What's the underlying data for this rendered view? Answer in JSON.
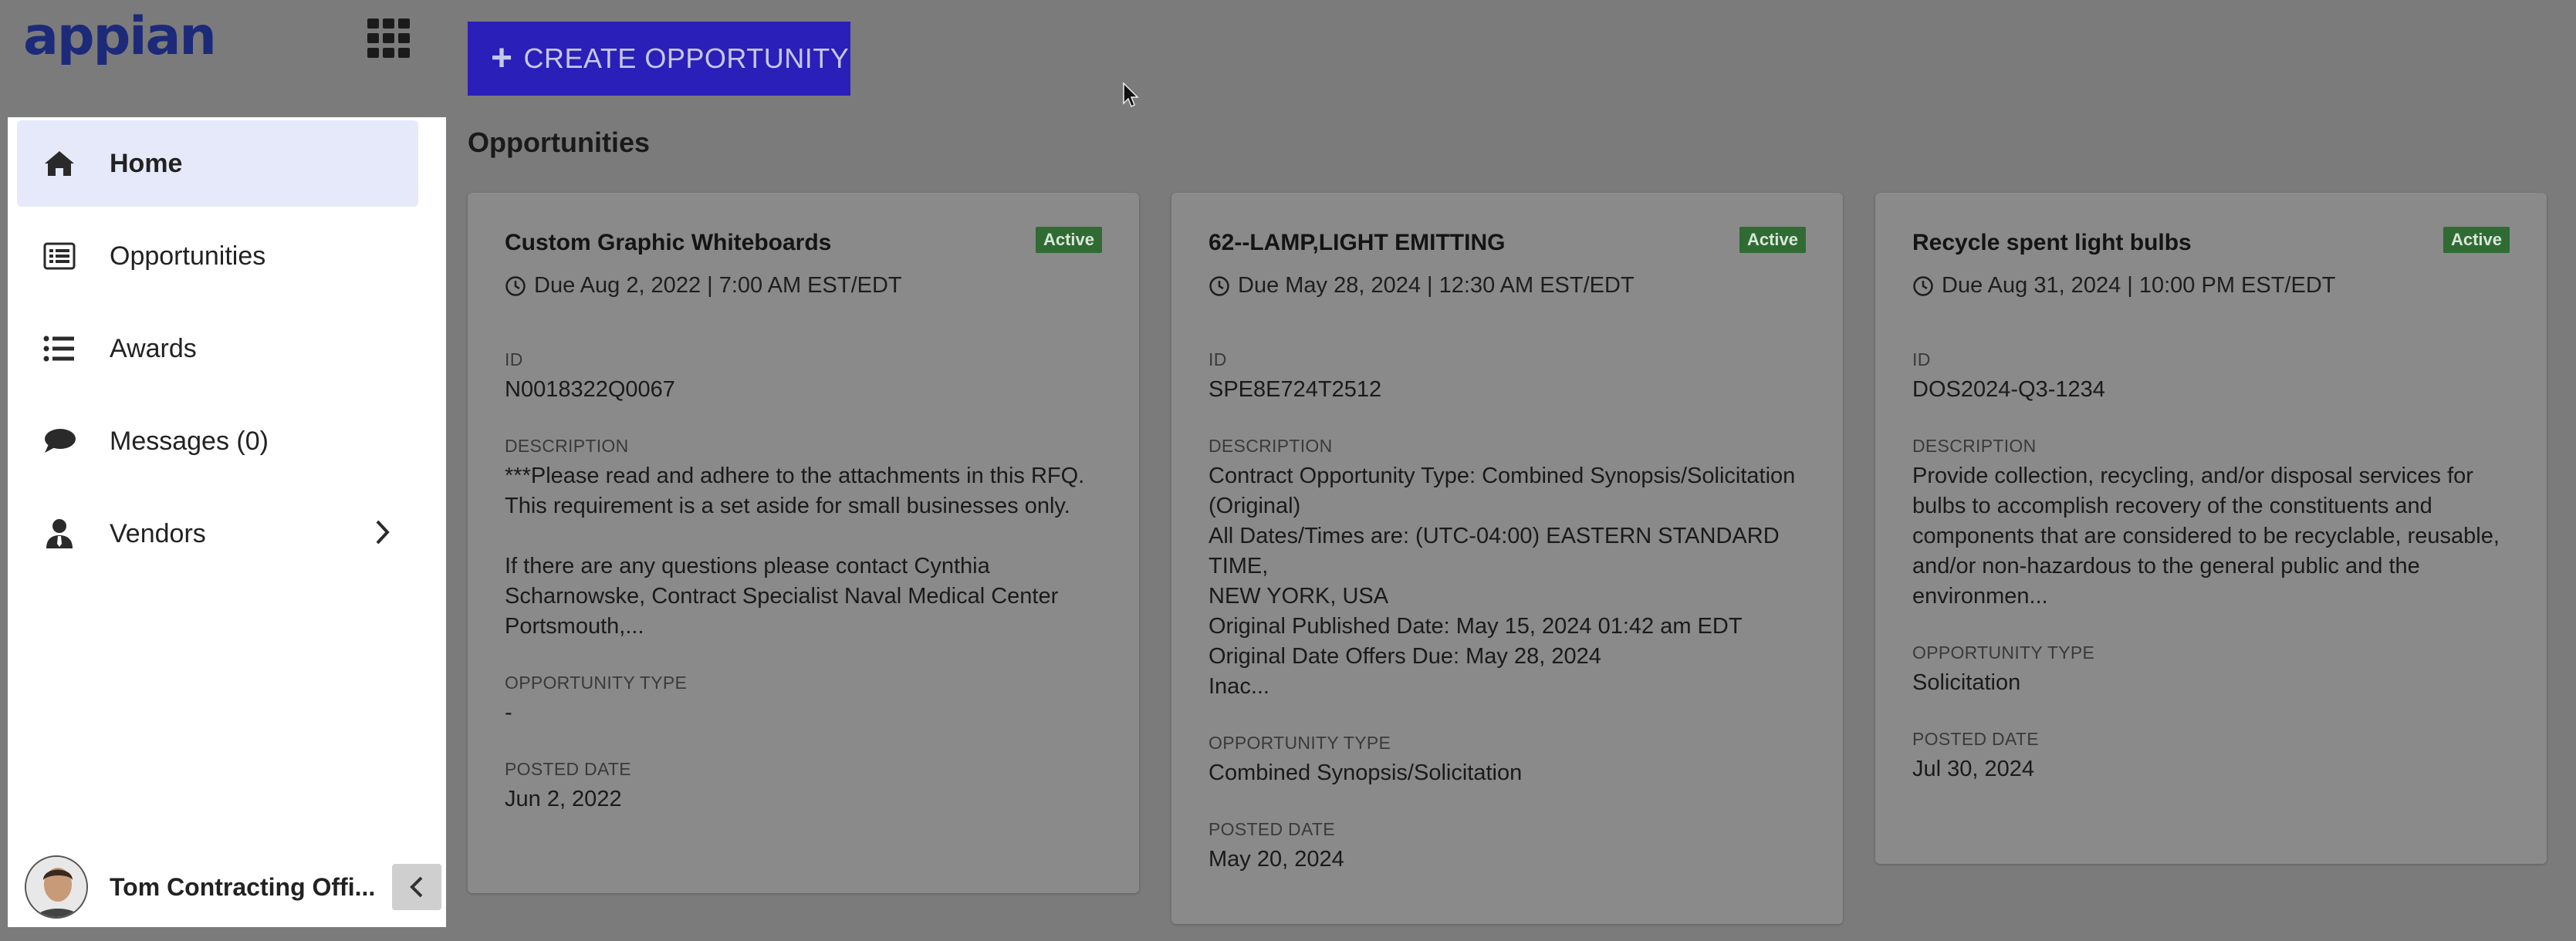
{
  "brand": {
    "logo_text": "appian"
  },
  "sidebar": {
    "items": [
      {
        "label": "Home",
        "icon": "home-icon",
        "active": true
      },
      {
        "label": "Opportunities",
        "icon": "list-alt-icon",
        "active": false
      },
      {
        "label": "Awards",
        "icon": "list-icon",
        "active": false
      },
      {
        "label": "Messages (0)",
        "icon": "comment-icon",
        "active": false
      },
      {
        "label": "Vendors",
        "icon": "user-tie-icon",
        "active": false,
        "has_submenu": true
      }
    ],
    "user_name": "Tom Contracting Offi..."
  },
  "main": {
    "create_button_label": "CREATE OPPORTUNITY",
    "section_title": "Opportunities",
    "cards": [
      {
        "title": "Custom Graphic Whiteboards",
        "status": "Active",
        "due": "Due Aug 2, 2022 | 7:00 AM EST/EDT",
        "id_label": "ID",
        "id": "N0018322Q0067",
        "description_label": "DESCRIPTION",
        "description": "***Please read and adhere to the attachments in this RFQ.\nThis requirement is a set aside for small businesses only.\n\nIf there are any questions please contact Cynthia\nScharnowske, Contract Specialist Naval Medical Center\nPortsmouth,...",
        "type_label": "OPPORTUNITY TYPE",
        "type": "-",
        "posted_label": "POSTED DATE",
        "posted": "Jun 2, 2022"
      },
      {
        "title": "62--LAMP,LIGHT EMITTING",
        "status": "Active",
        "due": "Due May 28, 2024 | 12:30 AM EST/EDT",
        "id_label": "ID",
        "id": "SPE8E724T2512",
        "description_label": "DESCRIPTION",
        "description": "Contract Opportunity Type: Combined Synopsis/Solicitation\n(Original)\nAll Dates/Times are: (UTC-04:00) EASTERN STANDARD TIME,\nNEW YORK, USA\nOriginal Published Date: May 15, 2024 01:42 am EDT\nOriginal Date Offers Due: May 28, 2024\nInac...",
        "type_label": "OPPORTUNITY TYPE",
        "type": "Combined Synopsis/Solicitation",
        "posted_label": "POSTED DATE",
        "posted": "May 20, 2024"
      },
      {
        "title": "Recycle spent light bulbs",
        "status": "Active",
        "due": "Due Aug 31, 2024 | 10:00 PM EST/EDT",
        "id_label": "ID",
        "id": "DOS2024-Q3-1234",
        "description_label": "DESCRIPTION",
        "description": "Provide collection, recycling, and/or disposal services for\nbulbs to accomplish recovery of the constituents and\ncomponents that are considered to be recyclable, reusable,\nand/or non-hazardous to the general public and the\nenvironmen...",
        "type_label": "OPPORTUNITY TYPE",
        "type": "Solicitation",
        "posted_label": "POSTED DATE",
        "posted": "Jul 30, 2024"
      }
    ]
  }
}
